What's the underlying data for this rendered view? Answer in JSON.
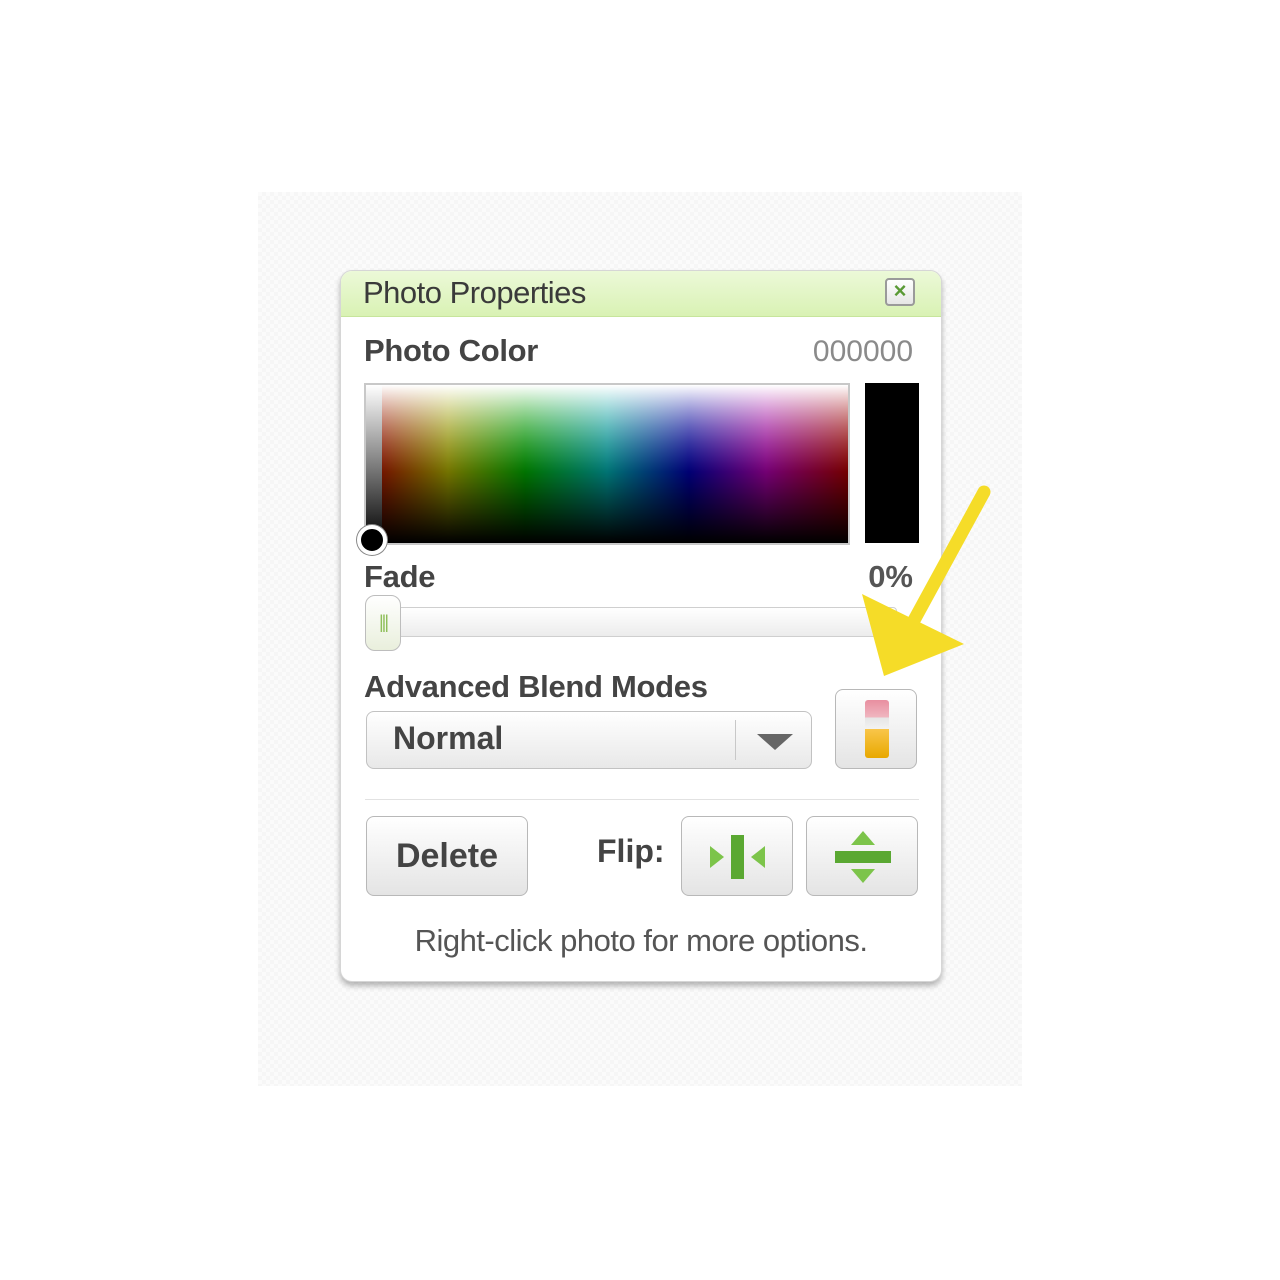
{
  "panel": {
    "title": "Photo Properties",
    "close_symbol": "×"
  },
  "color": {
    "label": "Photo Color",
    "hex": "000000",
    "swatch_color": "#000000"
  },
  "fade": {
    "label": "Fade",
    "value_text": "0%",
    "value": 0
  },
  "blend": {
    "label": "Advanced Blend Modes",
    "selected": "Normal"
  },
  "actions": {
    "delete_label": "Delete",
    "flip_label": "Flip:"
  },
  "hint": "Right-click photo for more options.",
  "icons": {
    "close": "close-icon",
    "dropdown": "chevron-down-icon",
    "blend": "gradient-icon",
    "flip_horizontal": "flip-horizontal-icon",
    "flip_vertical": "flip-vertical-icon",
    "annotation": "yellow-arrow-icon"
  },
  "colors": {
    "title_bar": "#d9f2b4",
    "accent_green": "#6ab23c",
    "annotation_arrow": "#f5dc28"
  }
}
